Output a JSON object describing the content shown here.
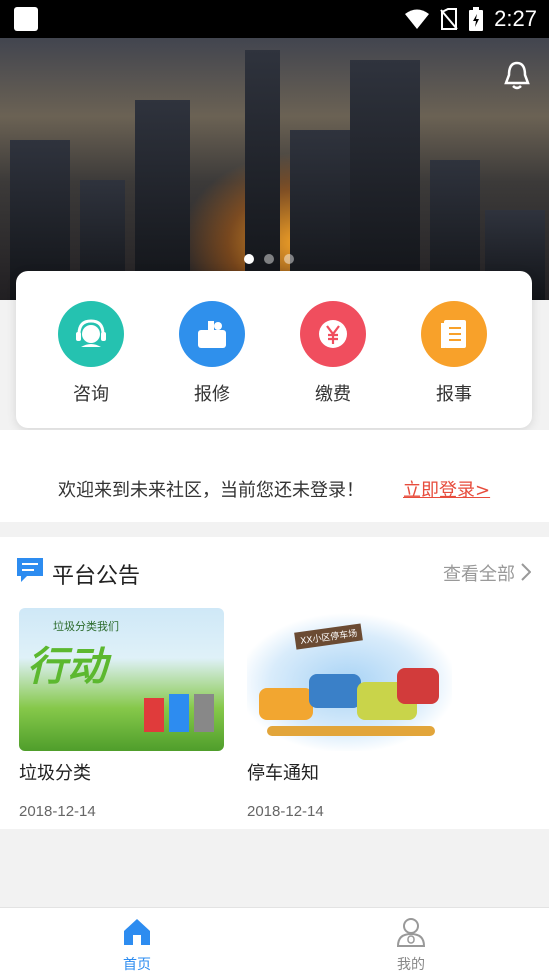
{
  "status_bar": {
    "time": "2:27"
  },
  "banner": {
    "slides": 3,
    "active_slide": 1
  },
  "services": [
    {
      "label": "咨询",
      "icon": "headset-icon",
      "color": "#25c2b0"
    },
    {
      "label": "报修",
      "icon": "toolbox-icon",
      "color": "#2f90ec"
    },
    {
      "label": "缴费",
      "icon": "yen-icon",
      "color": "#f04e5e"
    },
    {
      "label": "报事",
      "icon": "notes-icon",
      "color": "#f8a12a"
    }
  ],
  "welcome": {
    "message": "欢迎来到未来社区，当前您还未登录！",
    "login_link": "立即登录>"
  },
  "announcements": {
    "title": "平台公告",
    "view_all": "查看全部",
    "items": [
      {
        "title": "垃圾分类",
        "date": "2018-12-14",
        "image_text": [
          "垃圾分类我们",
          "行动"
        ]
      },
      {
        "title": "停车通知",
        "date": "2018-12-14",
        "image_text": [
          "XX小区停车场"
        ]
      }
    ]
  },
  "tabs": [
    {
      "label": "首页",
      "active": true
    },
    {
      "label": "我的",
      "active": false
    }
  ],
  "colors": {
    "accent": "#2d8cf0",
    "login": "#e74c3c"
  }
}
